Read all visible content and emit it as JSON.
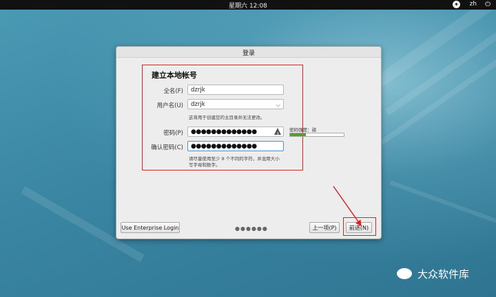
{
  "topbar": {
    "clock": "星期六 12:08",
    "lang": "zh",
    "a11y_icon": "accessibility-icon",
    "power_icon": "power-icon"
  },
  "dialog": {
    "title": "登录",
    "section_title": "建立本地帐号",
    "fullname": {
      "label": "全名(F)",
      "value": "dzrjk"
    },
    "username": {
      "label": "用户名(U)",
      "value": "dzrjk",
      "hint": "这将用于创建您的主目录并无法更改。"
    },
    "password": {
      "label": "密码(P)",
      "value": "●●●●●●●●●●●●●"
    },
    "confirm": {
      "label": "确认密码(C)",
      "value": "●●●●●●●●●●●●●"
    },
    "password_hint_line1": "请尽量使用至少 8 个不同的字符，并混用大小",
    "password_hint_line2": "写字母和数字。",
    "strength": {
      "label": "密码强度：弱",
      "level": 0.3,
      "color": "#5a9a30"
    },
    "enterprise_button": "Use Enterprise Login",
    "pager": "●●●●●●",
    "prev_button": "上一项(P)",
    "next_button": "前进(N)"
  },
  "watermark": {
    "text": "大众软件库"
  },
  "colors": {
    "highlight": "#e02020",
    "focus": "#4a90d9"
  }
}
